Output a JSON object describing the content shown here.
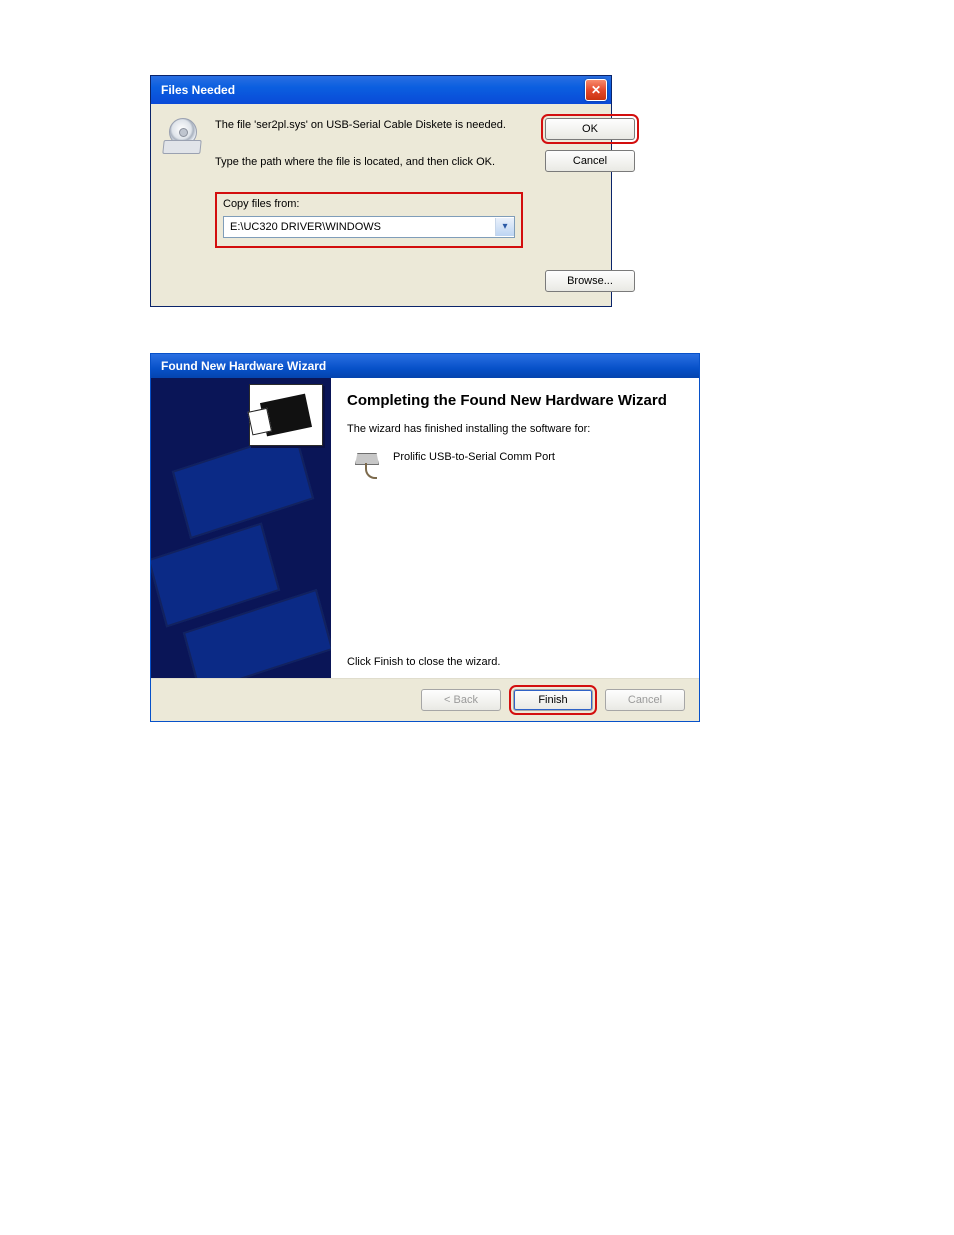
{
  "dialog1": {
    "title": "Files Needed",
    "message1": "The file 'ser2pl.sys' on USB-Serial Cable Diskete is needed.",
    "message2": "Type the path where the file is located, and then click OK.",
    "buttons": {
      "ok": "OK",
      "cancel": "Cancel",
      "browse": "Browse..."
    },
    "copy_label": "Copy files from:",
    "path_value": "E:\\UC320 DRIVER\\WINDOWS"
  },
  "dialog2": {
    "title": "Found New Hardware Wizard",
    "heading": "Completing the Found New Hardware Wizard",
    "subtext": "The wizard has finished installing the software for:",
    "device": "Prolific USB-to-Serial Comm Port",
    "closing": "Click Finish to close the wizard.",
    "buttons": {
      "back": "< Back",
      "finish": "Finish",
      "cancel": "Cancel"
    }
  }
}
